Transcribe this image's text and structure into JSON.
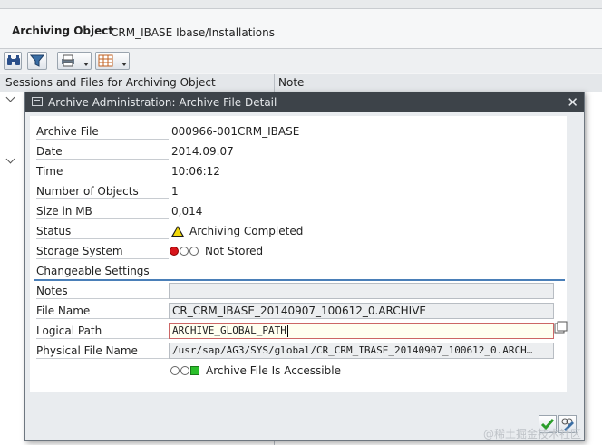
{
  "header": {
    "label": "Archiving Object",
    "value": "CRM_IBASE Ibase/Installations"
  },
  "toolbar": {
    "buttons": [
      "binoculars-icon",
      "filter-icon",
      "print-icon",
      "layout-icon"
    ]
  },
  "columns": {
    "col1": "Sessions and Files for Archiving Object",
    "col2": "Note"
  },
  "dialog": {
    "title": "Archive Administration: Archive File Detail",
    "close_glyph": "✕",
    "fields": {
      "archive_file": {
        "label": "Archive File",
        "value": "000966-001CRM_IBASE"
      },
      "date": {
        "label": "Date",
        "value": "2014.09.07"
      },
      "time": {
        "label": "Time",
        "value": "10:06:12"
      },
      "num_objects": {
        "label": "Number of Objects",
        "value": "1"
      },
      "size": {
        "label": "Size in MB",
        "value": "0,014"
      },
      "status": {
        "label": "Status",
        "value": "Archiving Completed",
        "icon": "warning-triangle-icon"
      },
      "storage": {
        "label": "Storage System",
        "value": "Not Stored",
        "icon": "red-light-icon"
      }
    },
    "section_title": "Changeable Settings",
    "settings": {
      "notes": {
        "label": "Notes",
        "value": ""
      },
      "file_name": {
        "label": "File Name",
        "value": "CR_CRM_IBASE_20140907_100612_0.ARCHIVE"
      },
      "logical_path": {
        "label": "Logical Path",
        "value": "ARCHIVE_GLOBAL_PATH"
      },
      "physical_file_name": {
        "label": "Physical File Name",
        "value": "/usr/sap/AG3/SYS/global/CR_CRM_IBASE_20140907_100612_0.ARCH…"
      }
    },
    "accessibility": {
      "value": "Archive File Is Accessible",
      "icon": "green-light-icon"
    },
    "buttons": {
      "ok": "ok-check-icon",
      "edit": "change-icon"
    }
  },
  "watermark": "@稀土掘金技术社区",
  "colors": {
    "title_bar": "#3d4349",
    "accent": "#4a7fb8",
    "ok_green": "#2a9d2a"
  }
}
